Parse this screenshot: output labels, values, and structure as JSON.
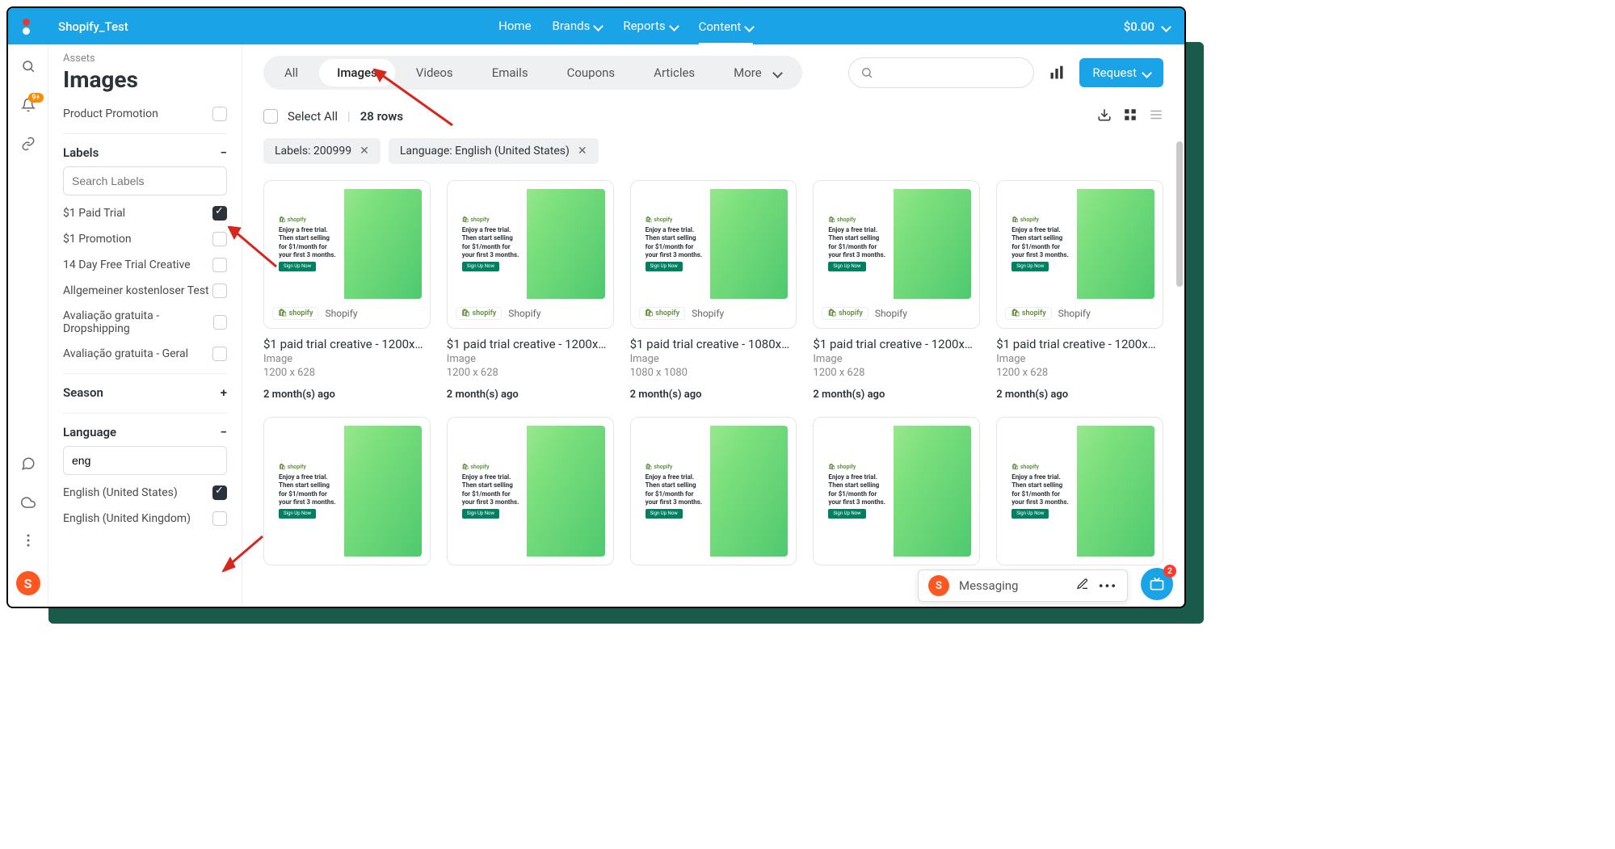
{
  "topbar": {
    "brand": "Shopify_Test",
    "nav": [
      {
        "label": "Home"
      },
      {
        "label": "Brands",
        "chevron": true
      },
      {
        "label": "Reports",
        "chevron": true
      },
      {
        "label": "Content",
        "chevron": true,
        "active": true
      }
    ],
    "balance": "$0.00"
  },
  "rail": {
    "notification_badge": "9+",
    "avatar": "S"
  },
  "sidebar": {
    "crumb": "Assets",
    "title": "Images",
    "facets": {
      "top": [
        {
          "label": "Product Promotion",
          "checked": false
        }
      ],
      "labels_header": "Labels",
      "labels_search_placeholder": "Search Labels",
      "labels": [
        {
          "label": "$1 Paid Trial",
          "checked": true
        },
        {
          "label": "$1 Promotion",
          "checked": false
        },
        {
          "label": "14 Day Free Trial Creative",
          "checked": false
        },
        {
          "label": "Allgemeiner kostenloser Test",
          "checked": false
        },
        {
          "label": "Avaliação gratuita - Dropshipping",
          "checked": false
        },
        {
          "label": "Avaliação gratuita - Geral",
          "checked": false
        }
      ],
      "season_header": "Season",
      "language_header": "Language",
      "language_value": "eng",
      "languages": [
        {
          "label": "English (United States)",
          "checked": true
        },
        {
          "label": "English (United Kingdom)",
          "checked": false
        }
      ]
    }
  },
  "content": {
    "tabs": [
      "All",
      "Images",
      "Videos",
      "Emails",
      "Coupons",
      "Articles",
      "More"
    ],
    "active_tab": "Images",
    "request_label": "Request",
    "select_all": "Select All",
    "row_count": "28 rows",
    "chips": [
      {
        "label": "Labels: 200999"
      },
      {
        "label": "Language: English (United States)"
      }
    ],
    "cards": [
      {
        "title": "$1 paid trial creative - 1200x…",
        "type": "Image",
        "dims": "1200 x 628",
        "ago": "2 month(s) ago",
        "brand": "Shopify"
      },
      {
        "title": "$1 paid trial creative - 1200x…",
        "type": "Image",
        "dims": "1200 x 628",
        "ago": "2 month(s) ago",
        "brand": "Shopify"
      },
      {
        "title": "$1 paid trial creative - 1080x…",
        "type": "Image",
        "dims": "1080 x 1080",
        "ago": "2 month(s) ago",
        "brand": "Shopify"
      },
      {
        "title": "$1 paid trial creative - 1200x…",
        "type": "Image",
        "dims": "1200 x 628",
        "ago": "2 month(s) ago",
        "brand": "Shopify"
      },
      {
        "title": "$1 paid trial creative - 1200x…",
        "type": "Image",
        "dims": "1200 x 628",
        "ago": "2 month(s) ago",
        "brand": "Shopify"
      },
      {
        "title": "",
        "type": "",
        "dims": "",
        "ago": "",
        "brand": ""
      },
      {
        "title": "",
        "type": "",
        "dims": "",
        "ago": "",
        "brand": ""
      },
      {
        "title": "",
        "type": "",
        "dims": "",
        "ago": "",
        "brand": ""
      },
      {
        "title": "",
        "type": "",
        "dims": "",
        "ago": "",
        "brand": ""
      },
      {
        "title": "",
        "type": "",
        "dims": "",
        "ago": "",
        "brand": ""
      }
    ],
    "thumb_copy": {
      "logo": "shopify",
      "headline": "Enjoy a free trial. Then start selling for $1/month for your first 3 months.",
      "cta": "Sign Up Now"
    }
  },
  "messaging": {
    "avatar": "S",
    "label": "Messaging",
    "fab_badge": "2"
  }
}
